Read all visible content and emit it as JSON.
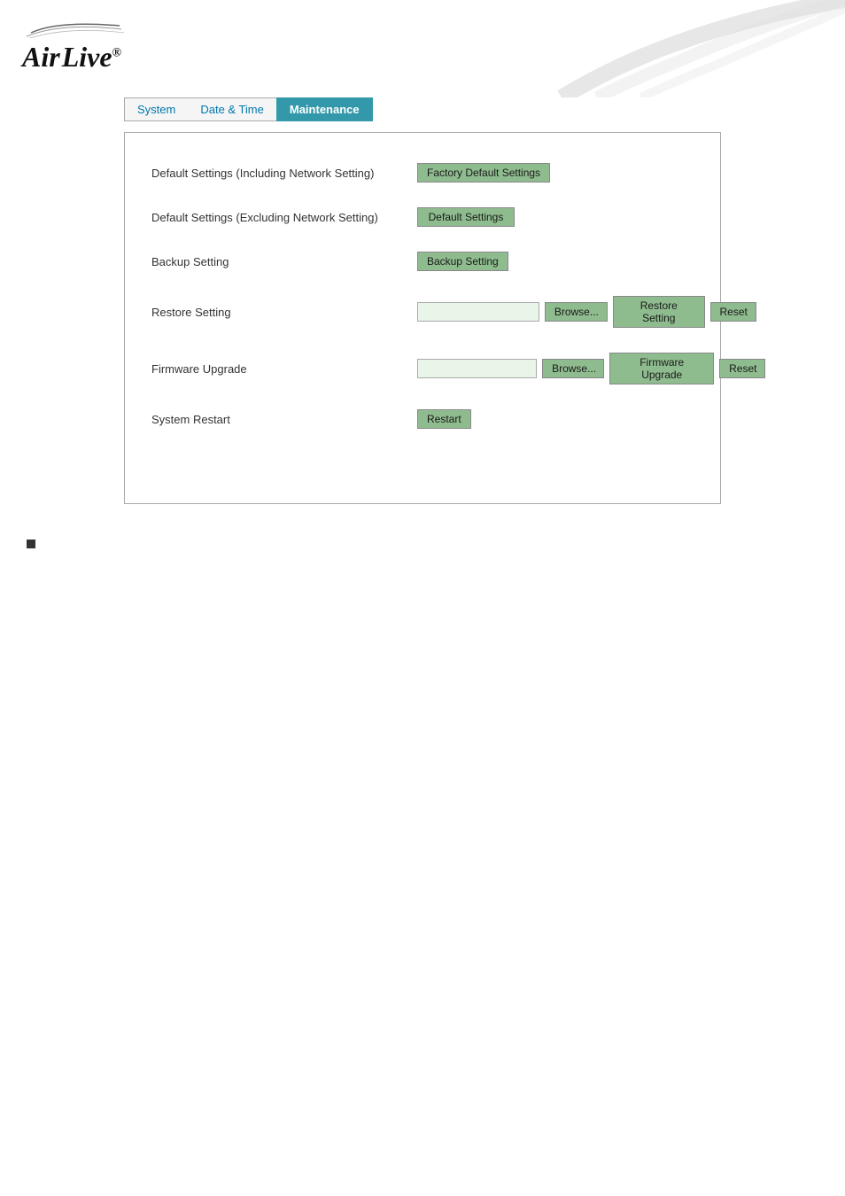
{
  "header": {
    "logo": {
      "air": "Air",
      "live": "Live",
      "registered": "®"
    }
  },
  "nav": {
    "tabs": [
      {
        "id": "system",
        "label": "System",
        "active": false
      },
      {
        "id": "date-time",
        "label": "Date & Time",
        "active": false
      },
      {
        "id": "maintenance",
        "label": "Maintenance",
        "active": true
      }
    ]
  },
  "main": {
    "rows": [
      {
        "id": "default-including",
        "label": "Default Settings (Including Network Setting)",
        "button": "Factory Default Settings"
      },
      {
        "id": "default-excluding",
        "label": "Default Settings (Excluding Network Setting)",
        "button": "Default Settings"
      },
      {
        "id": "backup",
        "label": "Backup Setting",
        "button": "Backup Setting"
      },
      {
        "id": "restore",
        "label": "Restore Setting",
        "browse": "Browse...",
        "action": "Restore Setting",
        "reset": "Reset"
      },
      {
        "id": "firmware",
        "label": "Firmware Upgrade",
        "browse": "Browse...",
        "action": "Firmware Upgrade",
        "reset": "Reset"
      },
      {
        "id": "restart",
        "label": "System Restart",
        "button": "Restart"
      }
    ]
  }
}
